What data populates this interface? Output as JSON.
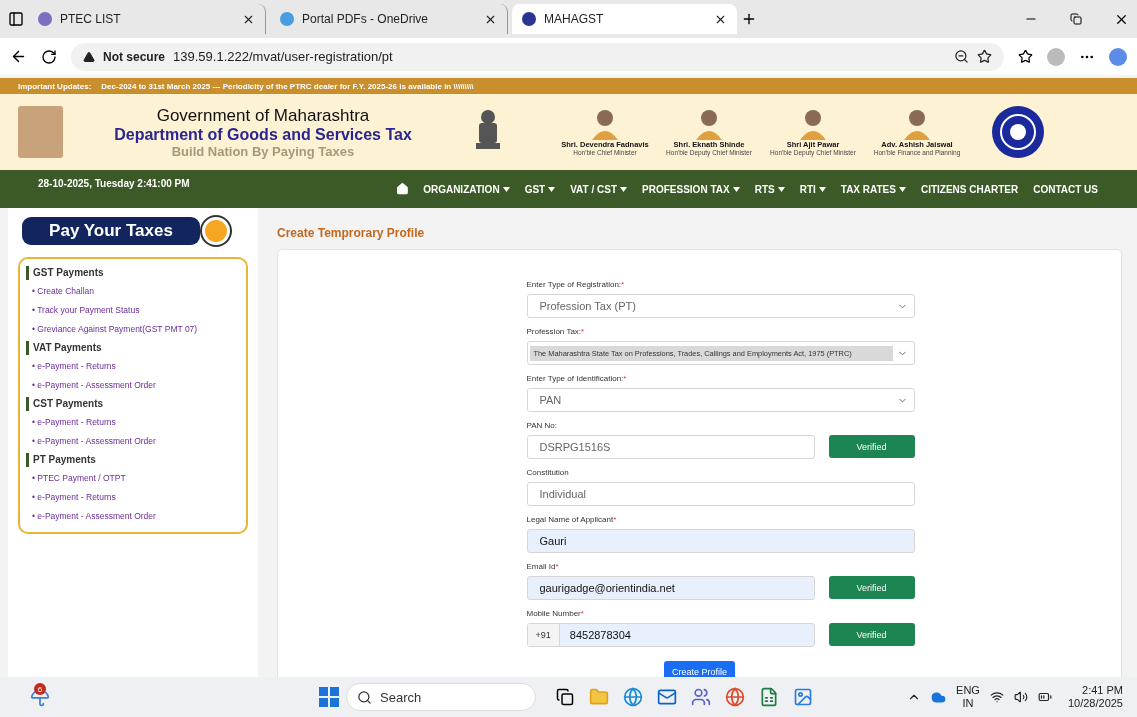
{
  "browser": {
    "tabs": [
      {
        "title": "PTEC LIST",
        "selected": false
      },
      {
        "title": "Portal PDFs - OneDrive",
        "selected": false
      },
      {
        "title": "MAHAGST",
        "selected": true
      }
    ],
    "security": "Not secure",
    "url": "139.59.1.222/mvat/user-registration/pt"
  },
  "updates": {
    "label": "Important Updates:",
    "text": "Dec-2024 to 31st March 2025 --- Periodicity of the PTRC dealer for F.Y. 2025-26 is available in \\\\\\\\\\\\\\\\\\"
  },
  "header": {
    "title": "Government of Maharashtra",
    "subtitle": "Department of Goods and Services Tax",
    "tagline": "Build Nation By Paying Taxes",
    "leaders": [
      {
        "name": "Shri. Devendra Fadnavis",
        "role": "Hon'ble Chief Minister"
      },
      {
        "name": "Shri. Eknath Shinde",
        "role": "Hon'ble Deputy Chief Minister"
      },
      {
        "name": "Shri Ajit Pawar",
        "role": "Hon'ble Deputy Chief Minister"
      },
      {
        "name": "Adv. Ashish Jaiswal",
        "role": "Hon'ble Finance and Planning"
      }
    ]
  },
  "nav": {
    "datetime": "28-10-2025, Tuesday 2:41:00 PM",
    "items": [
      {
        "label": "ORGANIZATION",
        "dropdown": true
      },
      {
        "label": "GST",
        "dropdown": true
      },
      {
        "label": "VAT / CST",
        "dropdown": true
      },
      {
        "label": "PROFESSION TAX",
        "dropdown": true
      },
      {
        "label": "RTS",
        "dropdown": true
      },
      {
        "label": "RTI",
        "dropdown": true
      },
      {
        "label": "TAX RATES",
        "dropdown": true
      },
      {
        "label": "CITIZENS CHARTER",
        "dropdown": false
      },
      {
        "label": "CONTACT US",
        "dropdown": false
      }
    ]
  },
  "sidebar": {
    "title": "Pay Your Taxes",
    "sections": [
      {
        "heading": "GST Payments",
        "links": [
          "• Create Challan",
          "• Track your Payment Status",
          "• Greviance Against Payment(GST PMT 07)"
        ]
      },
      {
        "heading": "VAT Payments",
        "links": [
          "• e-Payment - Returns",
          "• e-Payment - Assessment Order"
        ]
      },
      {
        "heading": "CST Payments",
        "links": [
          "• e-Payment - Returns",
          "• e-Payment - Assessment Order"
        ]
      },
      {
        "heading": "PT Payments",
        "links": [
          "• PTEC Payment / OTPT",
          "• e-Payment - Returns",
          "• e-Payment - Assessment Order"
        ]
      }
    ]
  },
  "form": {
    "title": "Create Temprorary Profile",
    "fields": [
      {
        "kind": "select",
        "label": "Enter Type of Registration:",
        "asterisk": "*",
        "value": "Profession Tax (PT)",
        "autofilled": false
      },
      {
        "kind": "chip-select",
        "label": "Profession Tax:",
        "asterisk": "*",
        "value": "The Maharashtra State Tax on Professions, Trades, Callings and Employments Act, 1975 (PTRC)",
        "autofilled": false
      },
      {
        "kind": "select",
        "label": "Enter Type of Identification:",
        "asterisk": "*",
        "value": "PAN",
        "autofilled": false
      },
      {
        "kind": "text",
        "label": "PAN No:",
        "value": "DSRPG1516S",
        "autofilled": false,
        "button": "Verified"
      },
      {
        "kind": "text",
        "label": "Constitution",
        "value": "Individual",
        "autofilled": false
      },
      {
        "kind": "text",
        "label": "Legal Name of Applicant",
        "asterisk": "*",
        "value": "Gauri",
        "autofilled": true
      },
      {
        "kind": "text",
        "label": "Email Id",
        "asterisk": "*",
        "value": "gaurigadge@orientindia.net",
        "autofilled": true,
        "button": "Verified"
      },
      {
        "kind": "phone",
        "label": "Mobile Number",
        "asterisk": "*",
        "prefix": "+91",
        "value": "8452878304",
        "autofilled": true,
        "button": "Verified"
      }
    ],
    "submit": "Create Profile"
  },
  "taskbar": {
    "weather_badge": "6",
    "search": "Search",
    "language": "ENG",
    "region": "IN",
    "time": "2:41 PM",
    "date": "10/28/2025"
  }
}
